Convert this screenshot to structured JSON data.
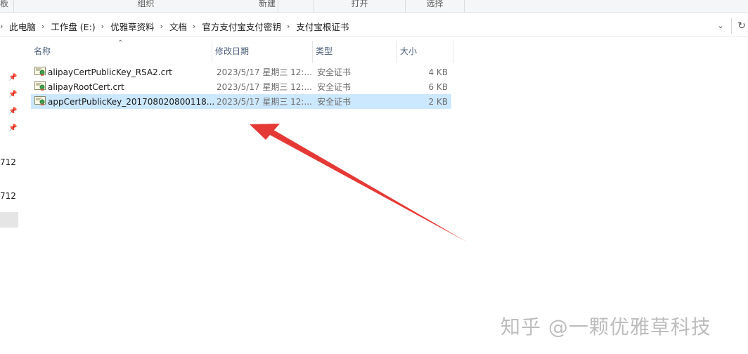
{
  "ribbon": {
    "groups": [
      {
        "label": "板"
      },
      {
        "label": "组织"
      },
      {
        "label": "新建"
      },
      {
        "label": "打开"
      },
      {
        "label": "选择"
      }
    ]
  },
  "address_bar": {
    "crumbs": [
      "此电脑",
      "工作盘 (E:)",
      "优雅草资料",
      "文档",
      "官方支付宝支付密钥",
      "支付宝根证书"
    ],
    "dropdown_icon": "chevron-down-icon",
    "refresh_icon": "refresh-icon"
  },
  "nav": {
    "cut_labels": [
      "712",
      "712"
    ]
  },
  "columns": {
    "name": "名称",
    "date": "修改日期",
    "type": "类型",
    "size": "大小"
  },
  "files": [
    {
      "name": "alipayCertPublicKey_RSA2.crt",
      "date": "2023/5/17 星期三 12:...",
      "type": "安全证书",
      "size": "4 KB",
      "selected": false
    },
    {
      "name": "alipayRootCert.crt",
      "date": "2023/5/17 星期三 12:...",
      "type": "安全证书",
      "size": "6 KB",
      "selected": false
    },
    {
      "name": "appCertPublicKey_201708020800118...",
      "date": "2023/5/17 星期三 12:...",
      "type": "安全证书",
      "size": "2 KB",
      "selected": true
    }
  ],
  "annotation": {
    "color": "#e53935"
  },
  "watermark": "知乎 @一颗优雅草科技",
  "colors": {
    "selection": "#cce8ff",
    "header_text": "#4c607a"
  }
}
